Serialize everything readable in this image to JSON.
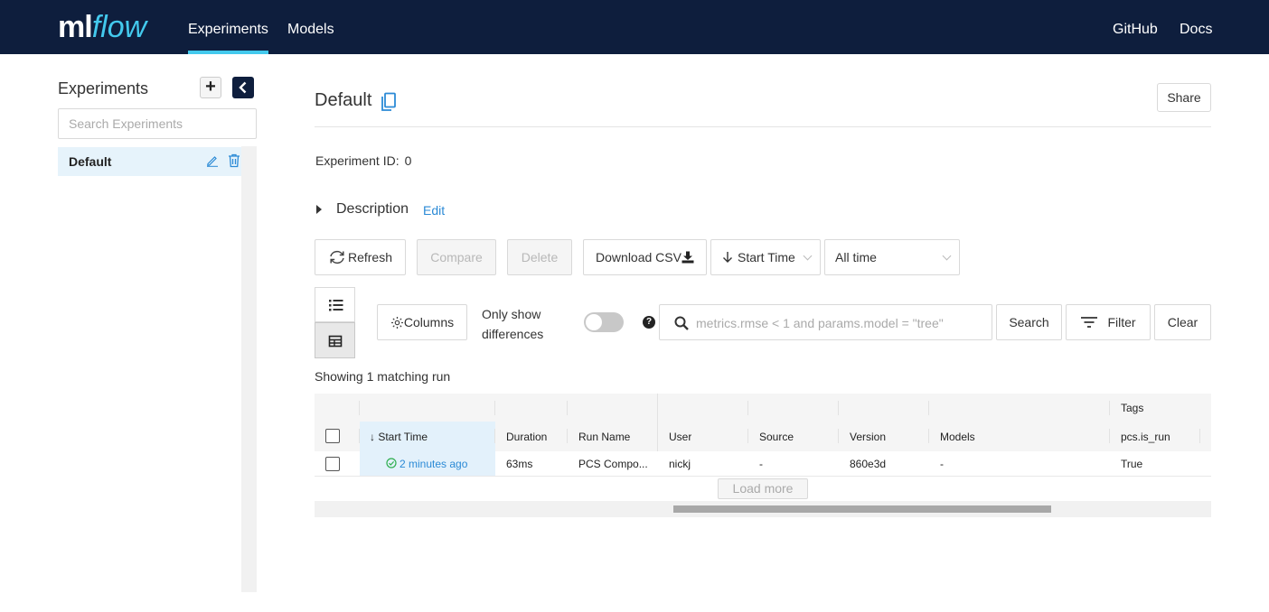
{
  "header": {
    "logo_ml": "ml",
    "logo_flow": "flow",
    "nav": [
      "Experiments",
      "Models"
    ],
    "right_links": [
      "GitHub",
      "Docs"
    ]
  },
  "sidebar": {
    "title": "Experiments",
    "search_placeholder": "Search Experiments",
    "items": [
      {
        "label": "Default"
      }
    ]
  },
  "experiment": {
    "title": "Default",
    "share_label": "Share",
    "id_label": "Experiment ID:",
    "id_value": "0",
    "description_label": "Description",
    "description_edit": "Edit"
  },
  "toolbar": {
    "refresh": "Refresh",
    "compare": "Compare",
    "delete": "Delete",
    "download_csv": "Download CSV",
    "sort_by": "Start Time",
    "time_range": "All time",
    "columns": "Columns",
    "only_show_diff": "Only show differences",
    "search_placeholder": "metrics.rmse < 1 and params.model = \"tree\"",
    "search": "Search",
    "filter": "Filter",
    "clear": "Clear"
  },
  "results": {
    "showing": "Showing 1 matching run",
    "group_header_tags": "Tags",
    "columns": [
      "Start Time",
      "Duration",
      "Run Name",
      "User",
      "Source",
      "Version",
      "Models",
      "pcs.is_run"
    ],
    "rows": [
      {
        "start_time": "2 minutes ago",
        "duration": "63ms",
        "run_name": "PCS Compo...",
        "user": "nickj",
        "source": "-",
        "version": "860e3d",
        "models": "-",
        "pcs_is_run": "True"
      }
    ],
    "load_more": "Load more"
  },
  "colors": {
    "header_bg": "#0e1e3d",
    "accent": "#43c9ed",
    "link": "#2b8ad6",
    "selected_bg": "#e6f3fb"
  }
}
